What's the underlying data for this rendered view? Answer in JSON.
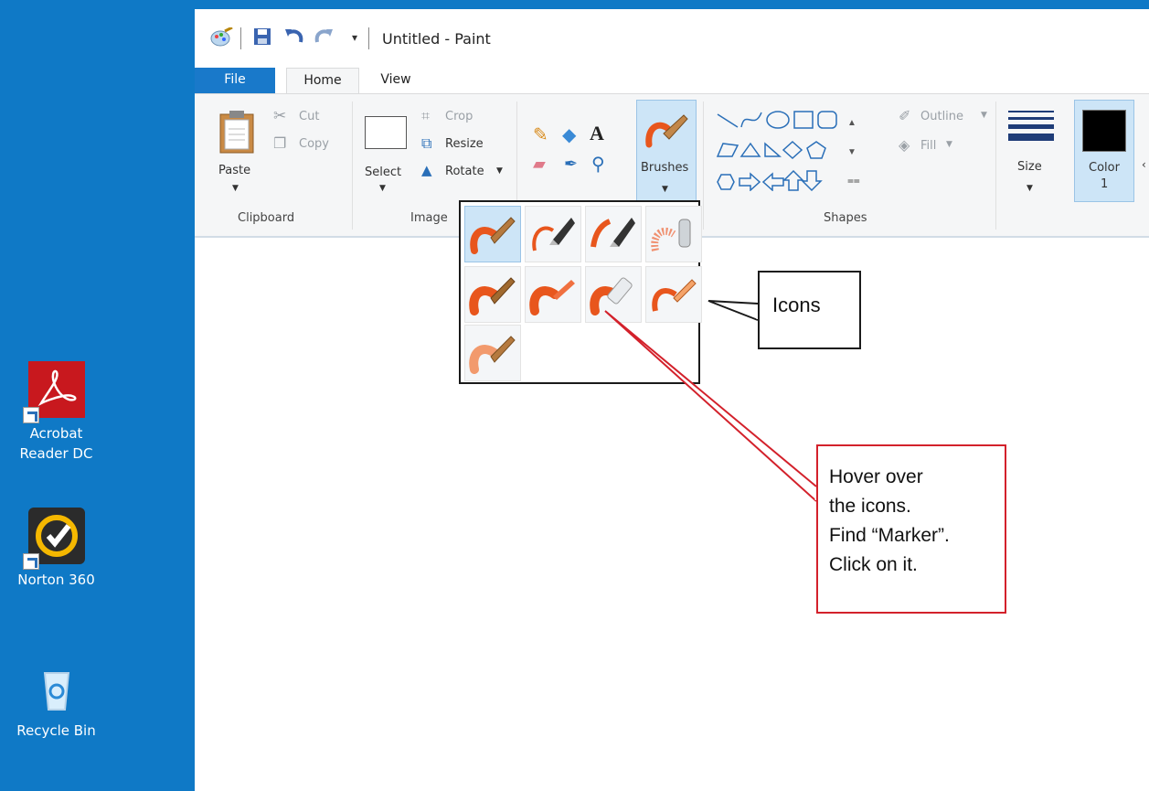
{
  "desktop": {
    "icons": [
      {
        "label_line1": "Acrobat",
        "label_line2": "Reader DC",
        "icon": "acrobat-reader-icon"
      },
      {
        "label_line1": "Norton 360",
        "icon": "norton-icon"
      },
      {
        "label_line1": "Recycle Bin",
        "icon": "recycle-bin-icon"
      }
    ]
  },
  "window": {
    "title": "Untitled - Paint",
    "tabs": [
      {
        "label": "File"
      },
      {
        "label": "Home"
      },
      {
        "label": "View"
      }
    ]
  },
  "ribbon": {
    "clipboard": {
      "paste": "Paste",
      "cut": "Cut",
      "copy": "Copy",
      "group": "Clipboard"
    },
    "image": {
      "select": "Select",
      "crop": "Crop",
      "resize": "Resize",
      "rotate": "Rotate",
      "group": "Image"
    },
    "brushes": {
      "label": "Brushes"
    },
    "shapes": {
      "outline": "Outline",
      "fill": "Fill",
      "group": "Shapes"
    },
    "size": {
      "label": "Size"
    },
    "color1": {
      "label": "Color",
      "number": "1"
    }
  },
  "callouts": {
    "icons": "Icons",
    "hover": [
      "Hover over",
      "the icons.",
      "Find “Marker”.",
      "Click on it."
    ]
  },
  "colors": {
    "desktop": "#0f79c6",
    "file_tab": "#1979ca",
    "brush_orange": "#e8561d",
    "callout_red": "#d3212b"
  }
}
